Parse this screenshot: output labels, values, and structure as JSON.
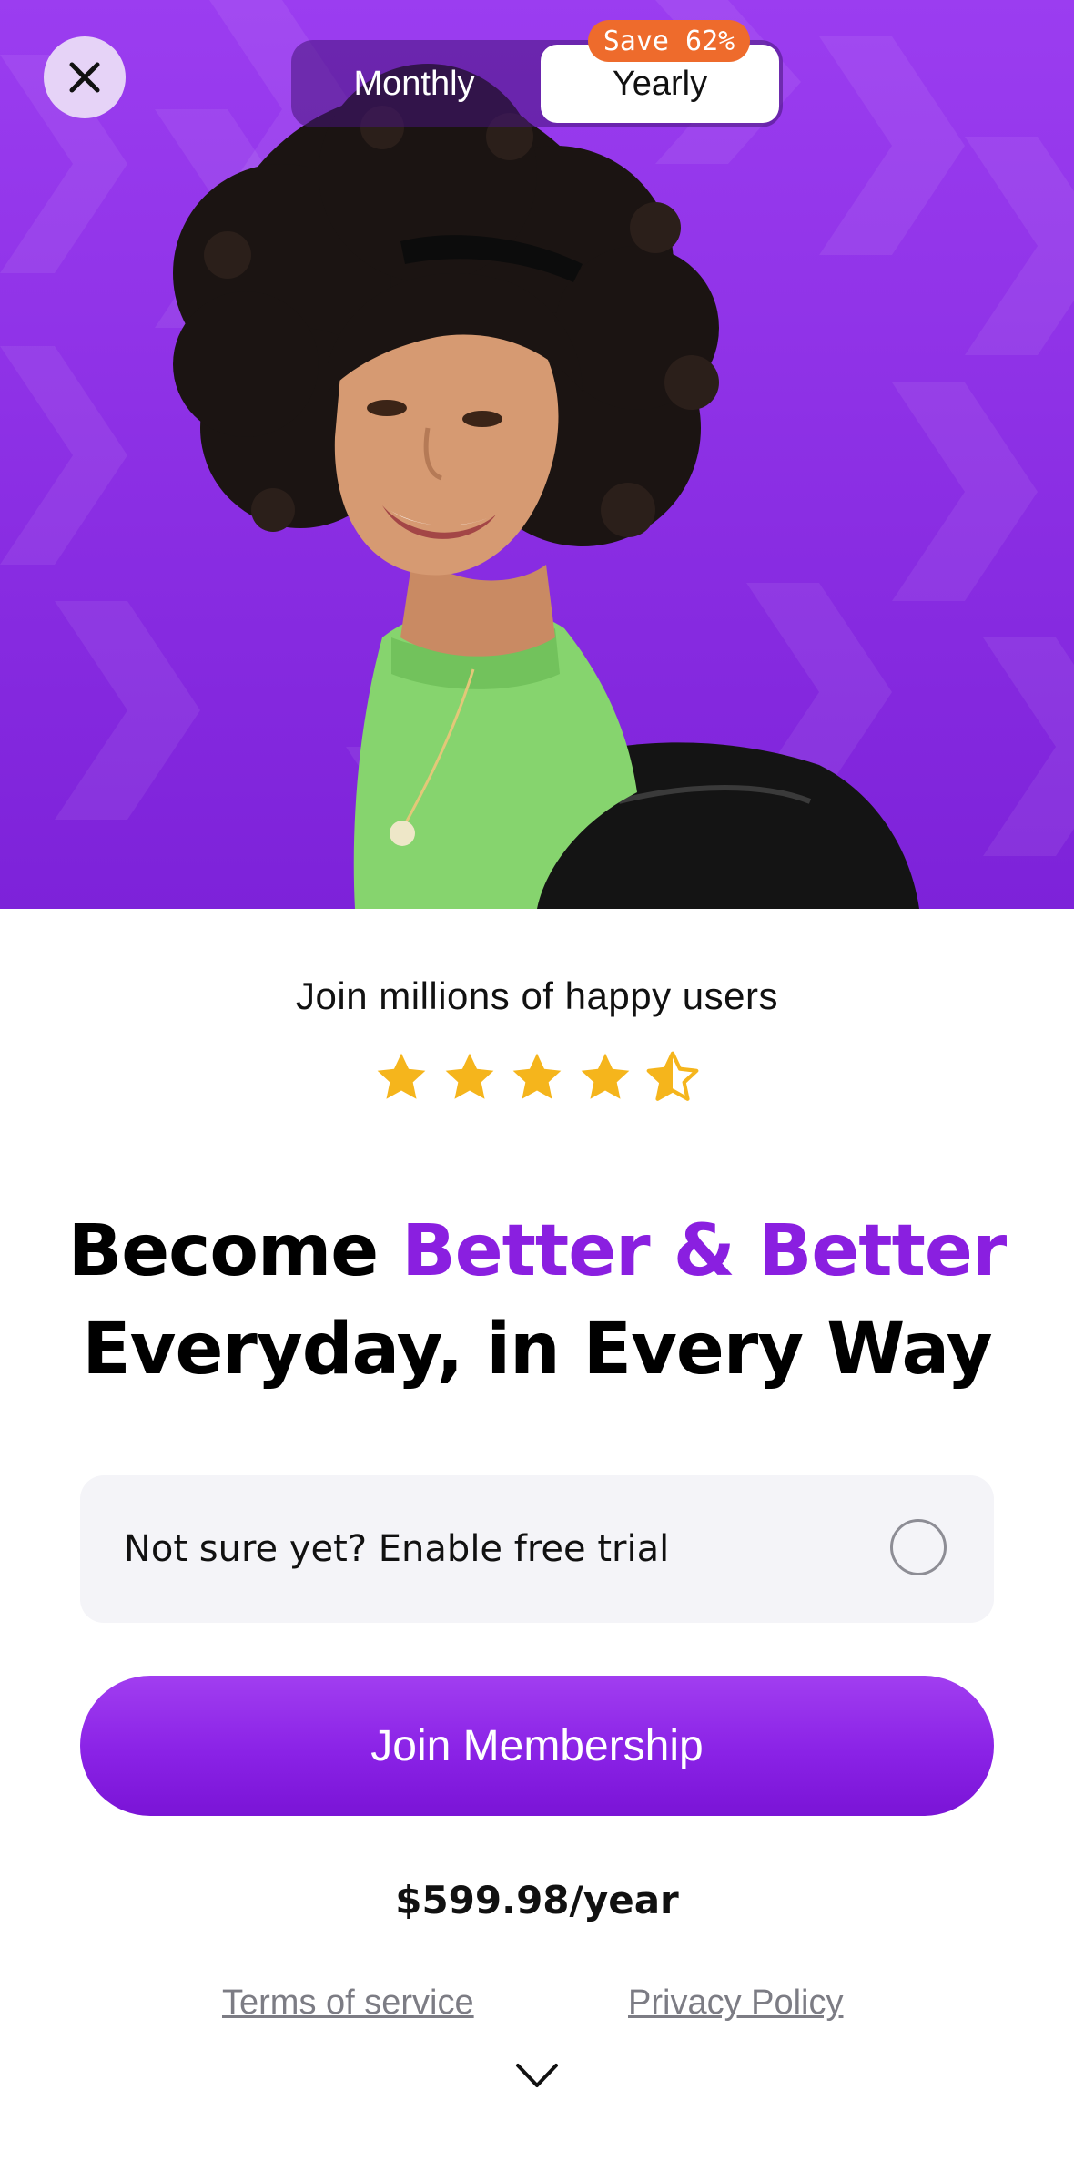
{
  "billing_toggle": {
    "monthly_label": "Monthly",
    "yearly_label": "Yearly",
    "selected": "Yearly",
    "save_badge": "Save 62%"
  },
  "close": {
    "icon": "close-icon"
  },
  "social_proof": {
    "text": "Join millions of happy users",
    "rating": 4.5,
    "max_rating": 5
  },
  "headline": {
    "part1": "Become ",
    "accent": "Better & Better",
    "line2": "Everyday, in Every Way"
  },
  "free_trial": {
    "label": "Not sure yet? Enable free trial",
    "enabled": false
  },
  "cta": {
    "label": "Join Membership"
  },
  "price": {
    "text": "$599.98/year"
  },
  "footer": {
    "terms_label": "Terms of service",
    "privacy_label": "Privacy Policy",
    "chevron_icon": "chevron-down-icon"
  },
  "colors": {
    "brand_purple": "#8a1fe0",
    "hero_background": "#8b2fe3",
    "save_badge": "#ee6b2c",
    "star": "#f5b51c",
    "trial_background": "#f4f4f8"
  }
}
